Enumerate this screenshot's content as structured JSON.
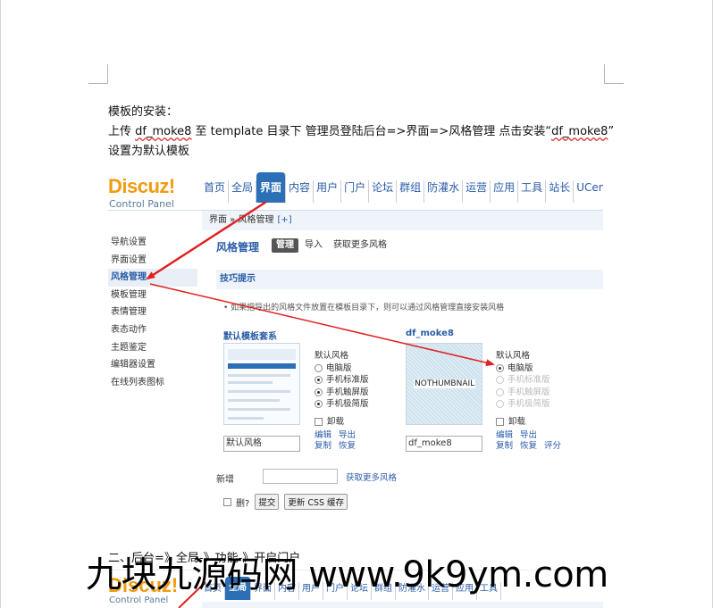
{
  "doc": {
    "line1": "模板的安装：",
    "line2_a": "上传 ",
    "line2_b": "df_moke8",
    "line2_c": " 至 template 目录下  管理员登陆后台=>界面=>风格管理  点击安装“",
    "line2_d": "df_moke8",
    "line2_e": "”",
    "line3": "设置为默认模板",
    "section2": "二、后台=》全局-》功能-》开启门户"
  },
  "screenshot": {
    "logo": "Discuz!",
    "logo_sub": "Control Panel",
    "nav": [
      "首页",
      "全局",
      "界面",
      "内容",
      "用户",
      "门户",
      "论坛",
      "群组",
      "防灌水",
      "运营",
      "应用",
      "工具",
      "站长",
      "UCenter"
    ],
    "nav_active": "界面",
    "breadcrumb": "界面 » 风格管理",
    "breadcrumb_plus": "[+]",
    "sidebar": [
      "导航设置",
      "界面设置",
      "风格管理",
      "模板管理",
      "表情管理",
      "表态动作",
      "主题鉴定",
      "编辑器设置",
      "在线列表图标"
    ],
    "sidebar_active": "风格管理",
    "page_title": "风格管理",
    "tabs": [
      "管理",
      "导入",
      "获取更多风格"
    ],
    "tip_title": "技巧提示",
    "tip_text": "如果把导出的风格文件放置在模板目录下，则可以通过风格管理直接安装风格",
    "templates": [
      {
        "name": "默认模板套系",
        "thumb_text": "",
        "default_label": "默认风格",
        "options": [
          "电脑版",
          "手机标准版",
          "手机触屏版",
          "手机极简版"
        ],
        "uninstall": "卸载",
        "links": [
          "编辑",
          "导出",
          "复制",
          "恢复"
        ],
        "input_value": "默认风格"
      },
      {
        "name": "df_moke8",
        "thumb_text": "NOTHUMBNAIL",
        "default_label": "默认风格",
        "options": [
          "电脑版",
          "手机标准版",
          "手机触屏版",
          "手机极简版"
        ],
        "uninstall": "卸载",
        "links": [
          "编辑",
          "导出",
          "复制",
          "恢复",
          "评分"
        ],
        "input_value": "df_moke8"
      }
    ],
    "new_label": "新增",
    "more_styles": "获取更多风格",
    "delete_label": "删?",
    "submit_button": "提交",
    "update_css_button": "更新 CSS 缓存"
  },
  "watermark": "九块九源码网 www.9k9ym.com",
  "colors": {
    "accent": "#2b6fb6",
    "logo": "#f39b0f",
    "arrow": "#e02020",
    "link": "#2a5ca8"
  }
}
